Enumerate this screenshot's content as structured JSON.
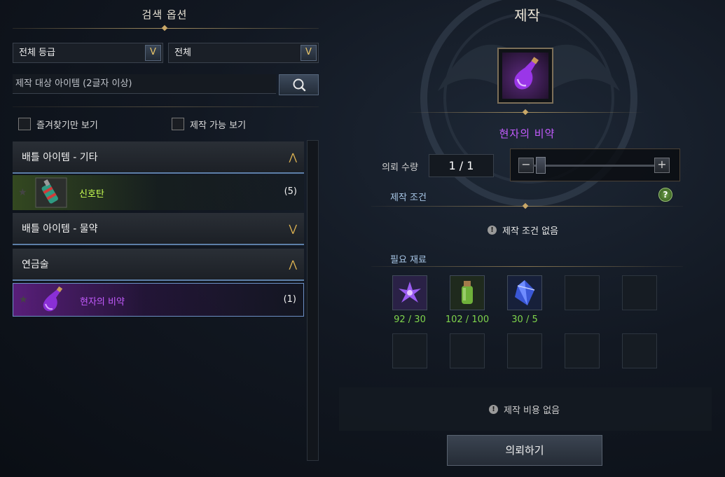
{
  "search": {
    "title": "검색 옵션",
    "grade_select": "전체 등급",
    "type_select": "전체",
    "placeholder": "제작 대상 아이템 (2글자 이상)",
    "favorites_only": "즐겨찾기만 보기",
    "craftable_only": "제작 가능 보기"
  },
  "categories": [
    {
      "label": "배틀 아이템 - 기타",
      "expanded": true
    },
    {
      "label": "배틀 아이템 - 물약",
      "expanded": false
    },
    {
      "label": "연금술",
      "expanded": true
    }
  ],
  "items": [
    {
      "name": "신호탄",
      "count": "(5)",
      "color": "#c9ff52",
      "icon": "signal-flare-icon"
    },
    {
      "name": "현자의 비약",
      "count": "(1)",
      "color": "#c45cff",
      "icon": "purple-potion-icon",
      "selected": true
    }
  ],
  "craft": {
    "title": "제작",
    "product_name": "현자의 비약",
    "qty_label": "의뢰 수량",
    "qty_value": "1 / 1",
    "condition_label": "제작 조건",
    "condition_text": "제작 조건 없음",
    "materials_label": "필요 재료",
    "materials": [
      {
        "count": "92 / 30",
        "icon": "purple-flower-icon"
      },
      {
        "count": "102 / 100",
        "icon": "green-bottle-icon"
      },
      {
        "count": "30 / 5",
        "icon": "blue-crystal-icon"
      }
    ],
    "cost_text": "제작 비용 없음",
    "request_button": "의뢰하기"
  },
  "colors": {
    "accent_gold": "#e2b653",
    "product_purple": "#c45cff",
    "material_green": "#7fd44c",
    "selected_border": "#6c8fc4"
  }
}
